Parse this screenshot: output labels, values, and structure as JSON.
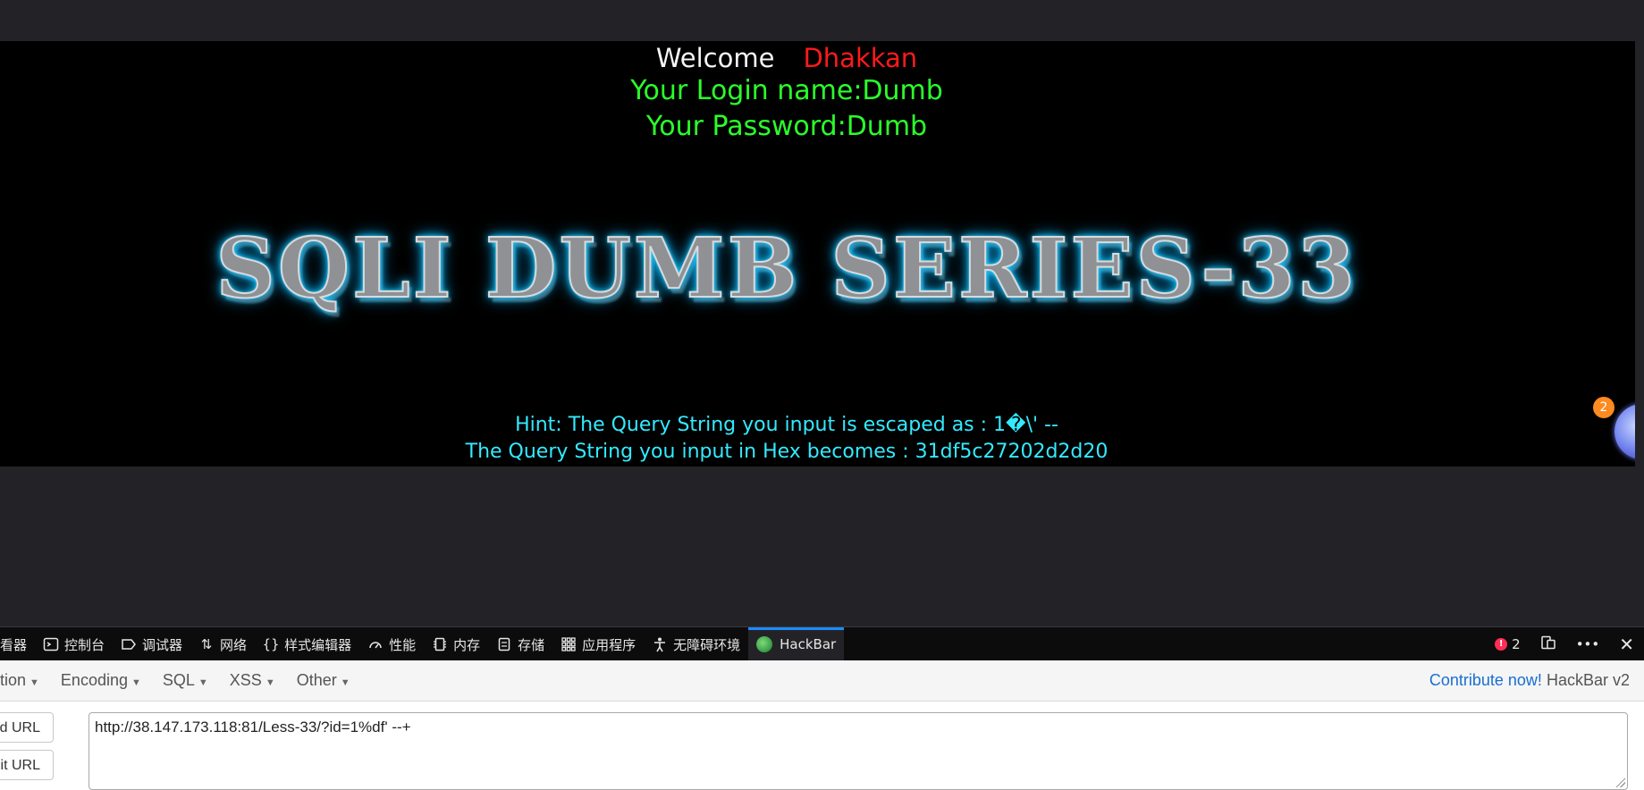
{
  "page": {
    "welcome_word": "Welcome",
    "welcome_name": "Dhakkan",
    "login_name": "Your Login name:Dumb",
    "password": "Your Password:Dumb",
    "banner_title": "SQLI DUMB SERIES-33",
    "hint": "Hint: The Query String you input is escaped as : 1�\\' --",
    "hex": "The Query String you input in Hex becomes : 31df5c27202d2d20",
    "widget_badge": "2"
  },
  "devtools": {
    "tabs": [
      {
        "label": "查看器",
        "icon": "inspector-icon"
      },
      {
        "label": "控制台",
        "icon": "console-icon"
      },
      {
        "label": "调试器",
        "icon": "debugger-icon"
      },
      {
        "label": "网络",
        "icon": "network-icon"
      },
      {
        "label": "样式编辑器",
        "icon": "style-editor-icon"
      },
      {
        "label": "性能",
        "icon": "performance-icon"
      },
      {
        "label": "内存",
        "icon": "memory-icon"
      },
      {
        "label": "存储",
        "icon": "storage-icon"
      },
      {
        "label": "应用程序",
        "icon": "application-icon"
      },
      {
        "label": "无障碍环境",
        "icon": "accessibility-icon"
      },
      {
        "label": "HackBar",
        "icon": "hackbar-icon"
      }
    ],
    "error_count": "2",
    "active_tab": "HackBar"
  },
  "hackbar": {
    "menu": [
      "tion",
      "Encoding",
      "SQL",
      "XSS",
      "Other"
    ],
    "contribute": "Contribute now!",
    "version": "HackBar v2",
    "load_url": "ad URL",
    "split_url": "lit URL",
    "url_value": "http://38.147.173.118:81/Less-33/?id=1%df' --+"
  },
  "colors": {
    "welcome_name": "#ff1a1a",
    "login_text": "#2bff2b",
    "hint_text": "#33eaff",
    "banner_glow": "#12c8ff",
    "accent": "#1a8cff"
  }
}
